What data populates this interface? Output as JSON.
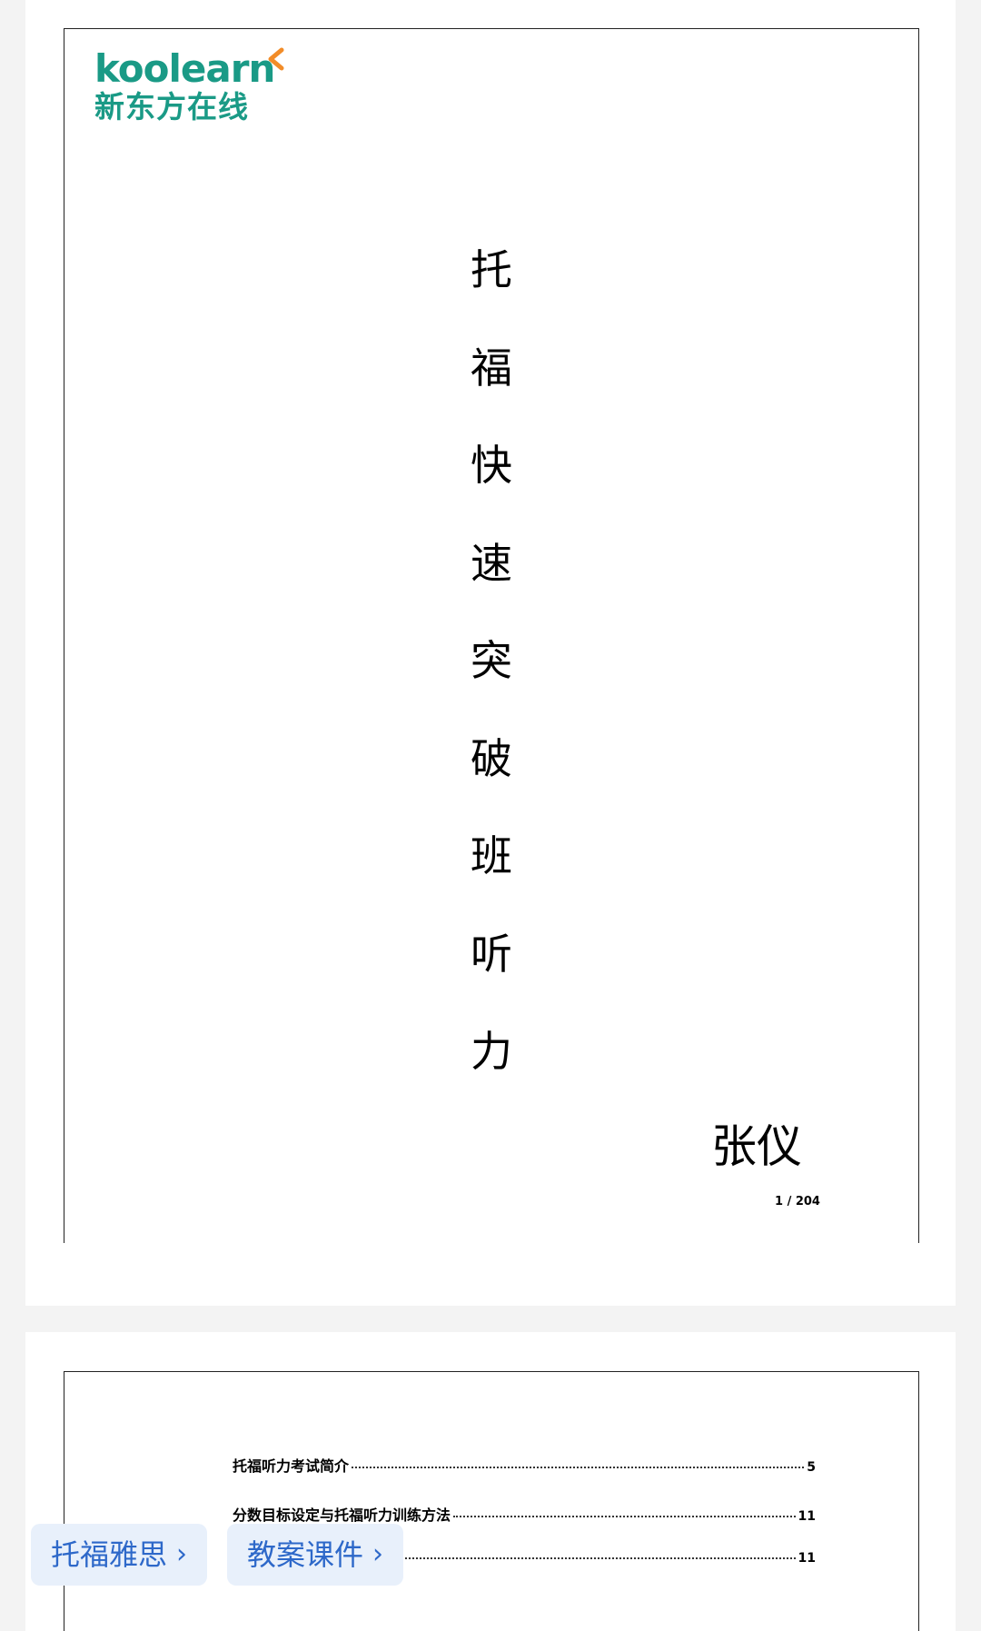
{
  "cover": {
    "logo_en": "koolearn",
    "logo_cn": "新东方在线",
    "title_chars": [
      "托",
      "福",
      "快",
      "速",
      "突",
      "破",
      "班",
      "听",
      "力"
    ],
    "author": "张仪",
    "page_indicator": "1 / 204"
  },
  "toc": {
    "entries": [
      {
        "title": "托福听力考试简介",
        "page": "5"
      },
      {
        "title": "分数目标设定与托福听力训练方法",
        "page": "11"
      },
      {
        "title": "",
        "page": "11"
      }
    ]
  },
  "tags": [
    {
      "label": "托福雅思",
      "chevron": "›"
    },
    {
      "label": "教案课件",
      "chevron": "›"
    }
  ],
  "colors": {
    "brand": "#1a9a86",
    "brand_accent": "#f28c28",
    "tag_text": "#2d68c9",
    "tag_bg": "#e8f0fb"
  }
}
